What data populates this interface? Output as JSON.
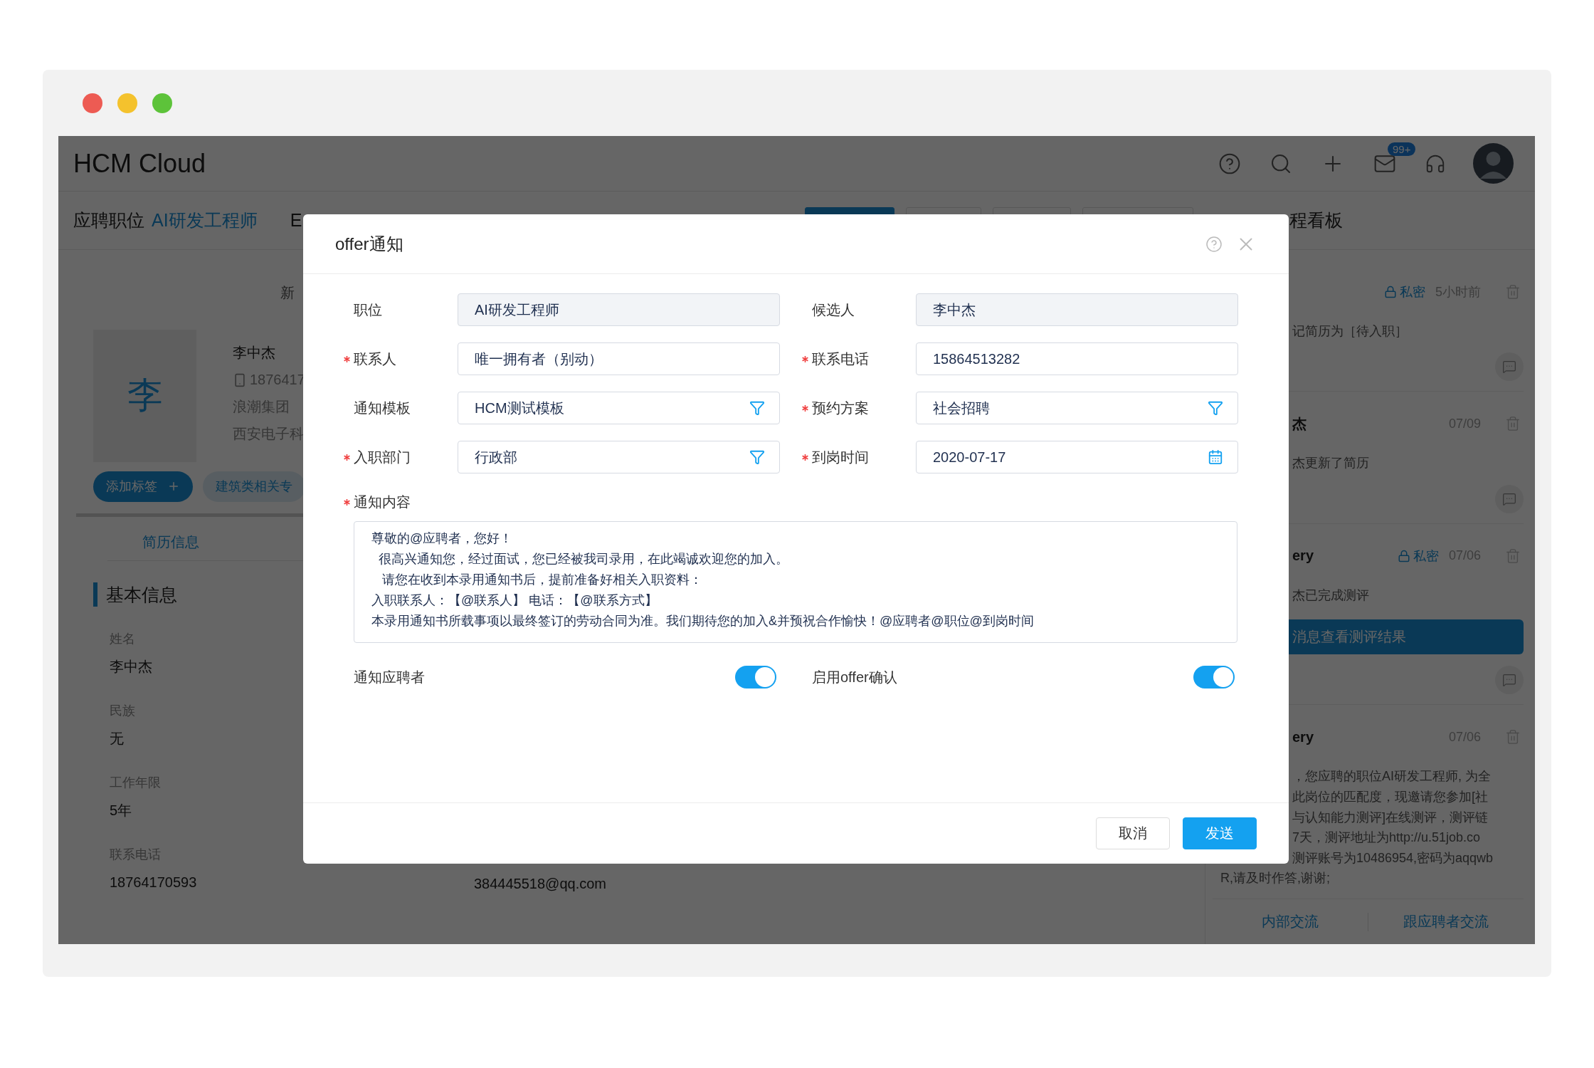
{
  "window": {
    "traffic_lights": [
      {
        "color": "#ed5b53"
      },
      {
        "color": "#f4c22d"
      },
      {
        "color": "#5dc33a"
      }
    ]
  },
  "header": {
    "title": "HCM Cloud",
    "badge": "99+"
  },
  "subheader": {
    "label": "应聘职位",
    "position": "AI研发工程师",
    "cut_text": "E",
    "tabs": [
      {
        "selected": true
      },
      {
        "selected": false
      },
      {
        "selected": false
      },
      {
        "selected": false
      }
    ],
    "board_title": "程看板"
  },
  "candidate": {
    "new_label": "新",
    "avatar": "李",
    "name": "李中杰",
    "phone": "1876417",
    "company": "浪潮集团",
    "school": "西安电子科",
    "tags": [
      {
        "label": "添加标签",
        "kind": "add"
      },
      {
        "label": "建筑类相关专",
        "kind": "tag"
      }
    ]
  },
  "resume_tabs": [
    {
      "label": "简历信息",
      "selected": true
    }
  ],
  "basic_info": {
    "title": "基本信息",
    "fields": [
      {
        "label": "姓名",
        "value": "李中杰"
      },
      {
        "label": "民族",
        "value": "无"
      },
      {
        "label": "工作年限",
        "value": "5年"
      },
      {
        "label": "联系电话",
        "value": "18764170593"
      }
    ],
    "email": "384445518@qq.com"
  },
  "activity": {
    "items": [
      {
        "private": true,
        "private_label": "私密",
        "time": "5小时前",
        "lines": [
          "记简历为［待入职］"
        ],
        "comment_button": true
      },
      {
        "author": "杰",
        "private": false,
        "time": "07/09",
        "lines": [
          "杰更新了简历"
        ],
        "comment_button": true
      },
      {
        "author": "ery",
        "private": true,
        "private_label": "私密",
        "time": "07/06",
        "lines": [
          "杰已完成测评"
        ],
        "action": "消息查看测评结果",
        "comment_button": true
      },
      {
        "author": "ery",
        "private": false,
        "time": "07/06",
        "lines": [
          "，您应聘的职位AI研发工程师, 为全",
          "此岗位的匹配度，现邀请您参加[社",
          "与认知能力测评]在线测评，测评链",
          "7天，测评地址为http://u.51job.co",
          "测评账号为10486954,密码为aqqwb"
        ],
        "tail": "R,请及时作答,谢谢;",
        "comment_button": false
      }
    ],
    "footer": [
      "内部交流",
      "跟应聘者交流"
    ]
  },
  "dialog": {
    "title": "offer通知",
    "fields": [
      {
        "label": "职位",
        "value": "AI研发工程师",
        "required": false,
        "kind": "readonly"
      },
      {
        "label": "候选人",
        "value": "李中杰",
        "required": false,
        "kind": "readonly"
      },
      {
        "label": "联系人",
        "value": "唯一拥有者（别动）",
        "required": true,
        "kind": "text"
      },
      {
        "label": "联系电话",
        "value": "15864513282",
        "required": true,
        "kind": "text"
      },
      {
        "label": "通知模板",
        "value": "HCM测试模板",
        "required": false,
        "kind": "filter"
      },
      {
        "label": "预约方案",
        "value": "社会招聘",
        "required": true,
        "kind": "filter"
      },
      {
        "label": "入职部门",
        "value": "行政部",
        "required": true,
        "kind": "filter"
      },
      {
        "label": "到岗时间",
        "value": "2020-07-17",
        "required": true,
        "kind": "date"
      }
    ],
    "content": {
      "label": "通知内容",
      "required": true,
      "lines": [
        "尊敬的@应聘者，您好！",
        "  很高兴通知您，经过面试，您已经被我司录用，在此竭诚欢迎您的加入。",
        "   请您在收到本录用通知书后，提前准备好相关入职资料：",
        "入职联系人：【@联系人】 电话：【@联系方式】",
        "本录用通知书所载事项以最终签订的劳动合同为准。我们期待您的加入&并预祝合作愉快！@应聘者@职位@到岗时间"
      ]
    },
    "toggles": [
      {
        "label": "通知应聘者",
        "on": true
      },
      {
        "label": "启用offer确认",
        "on": true
      }
    ],
    "buttons": [
      {
        "label": "取消",
        "kind": "secondary"
      },
      {
        "label": "发送",
        "kind": "primary"
      }
    ]
  }
}
